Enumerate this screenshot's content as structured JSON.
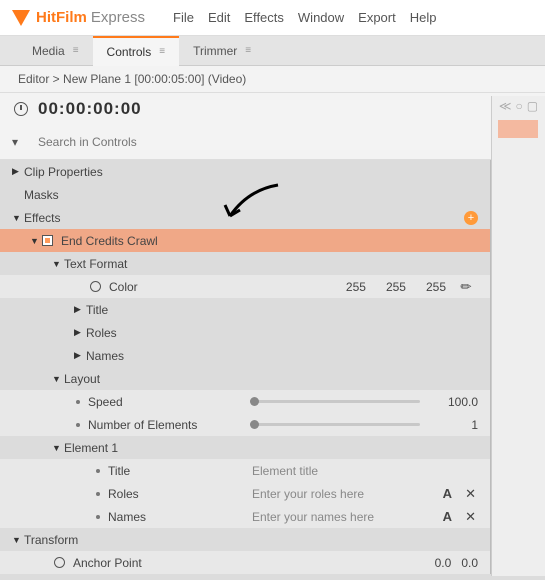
{
  "app": {
    "logo1": "HitFilm",
    "logo2": "Express"
  },
  "menu": [
    "File",
    "Edit",
    "Effects",
    "Window",
    "Export",
    "Help"
  ],
  "tabs": {
    "media": "Media",
    "controls": "Controls",
    "trimmer": "Trimmer"
  },
  "breadcrumb": "Editor > New Plane 1 [00:00:05:00] (Video)",
  "timecode": "00:00:00:00",
  "search": {
    "placeholder": "Search in Controls"
  },
  "tree": {
    "clip_properties": "Clip Properties",
    "masks": "Masks",
    "effects": "Effects",
    "end_credits": "End Credits Crawl",
    "text_format": "Text Format",
    "color": "Color",
    "color_vals": [
      "255",
      "255",
      "255"
    ],
    "title": "Title",
    "roles": "Roles",
    "names": "Names",
    "layout": "Layout",
    "speed": "Speed",
    "speed_val": "100.0",
    "num_elements": "Number of Elements",
    "num_elements_val": "1",
    "element1": "Element 1",
    "el_title": "Title",
    "el_title_ph": "Element title",
    "el_roles": "Roles",
    "el_roles_ph": "Enter your roles here",
    "el_names": "Names",
    "el_names_ph": "Enter your names here",
    "transform": "Transform",
    "anchor": "Anchor Point",
    "anchor_vals": [
      "0.0",
      "0.0"
    ]
  }
}
